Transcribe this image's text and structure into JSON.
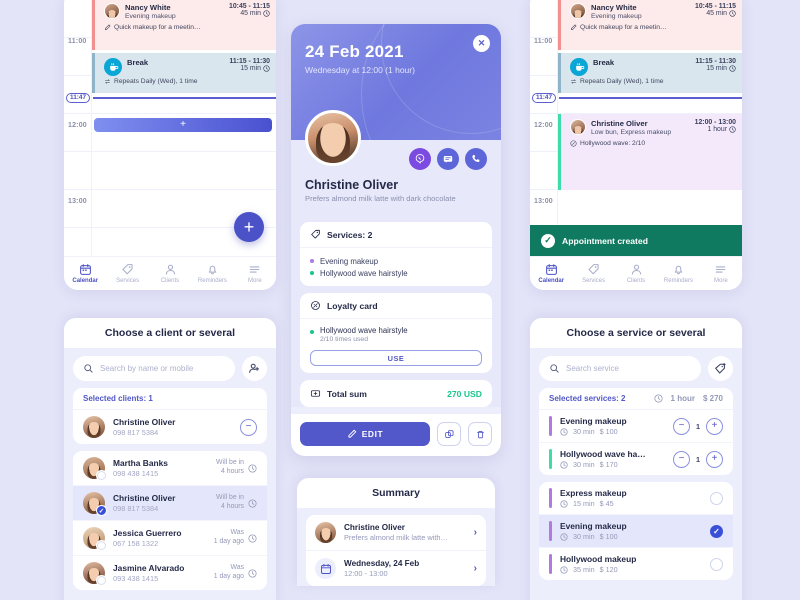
{
  "app": {
    "background": "#e3e4f8",
    "accent": "#5257c9",
    "green": "#19c58a",
    "toast_green": "#0f7a5f",
    "purple_service": "#b07ae0",
    "teal_service": "#3ddcab"
  },
  "tabbar": {
    "items": [
      {
        "label": "Calendar",
        "icon": "calendar-icon",
        "active": true
      },
      {
        "label": "Services",
        "icon": "tag-icon",
        "active": false
      },
      {
        "label": "Clients",
        "icon": "person-icon",
        "active": false
      },
      {
        "label": "Reminders",
        "icon": "bell-icon",
        "active": false
      },
      {
        "label": "More",
        "icon": "menu-icon",
        "active": false
      }
    ]
  },
  "calendar_left": {
    "hours": [
      "11:00",
      "12:00",
      "13:00"
    ],
    "now_label": "11:47",
    "add_slot_label": "+",
    "fab_label": "+",
    "appointments": [
      {
        "name": "Nancy White",
        "service": "Evening makeup",
        "note": "Quick makeup for a meetin…",
        "time": "10:45 - 11:15",
        "duration": "45 min",
        "type": "pink"
      },
      {
        "name": "Break",
        "note": "Repeats Daily (Wed), 1 time",
        "time": "11:15 - 11:30",
        "duration": "15 min",
        "type": "break"
      }
    ]
  },
  "calendar_right": {
    "hours": [
      "11:00",
      "12:00",
      "13:00"
    ],
    "now_label": "11:47",
    "appointments": [
      {
        "name": "Nancy White",
        "service": "Evening makeup",
        "note": "Quick makeup for a meetin…",
        "time": "10:45 - 11:15",
        "duration": "45 min",
        "type": "pink"
      },
      {
        "name": "Break",
        "note": "Repeats Daily (Wed), 1 time",
        "time": "11:15 - 11:30",
        "duration": "15 min",
        "type": "break"
      },
      {
        "name": "Christine Oliver",
        "service": "Low bun, Express makeup",
        "note": "Hollywood wave: 2/10",
        "time": "12:00 - 13:00",
        "duration": "1 hour",
        "type": "purple"
      }
    ],
    "toast": "Appointment created"
  },
  "detail": {
    "date": "24 Feb 2021",
    "when": "Wednesday at 12:00 (1 hour)",
    "close_label": "✕",
    "client_name": "Christine Oliver",
    "client_note": "Prefers almond milk latte with dark chocolate",
    "contacts": [
      {
        "name": "viber-icon"
      },
      {
        "name": "message-icon"
      },
      {
        "name": "phone-icon"
      }
    ],
    "services_title": "Services: 2",
    "services": [
      {
        "label": "Evening makeup",
        "color": "#b07ae0"
      },
      {
        "label": "Hollywood wave hairstyle",
        "color": "#19c58a"
      }
    ],
    "loyalty_title": "Loyalty card",
    "loyalty_service": "Hollywood wave hairstyle",
    "loyalty_progress": "2/10 times used",
    "loyalty_button": "USE",
    "total_label": "Total sum",
    "total_value": "270 USD",
    "edit_label": "EDIT",
    "copy_icon": "copy-icon",
    "delete_icon": "trash-icon"
  },
  "summary": {
    "title": "Summary",
    "rows": [
      {
        "title": "Christine Oliver",
        "sub": "Prefers almond milk latte with…",
        "icon": "avatar"
      },
      {
        "title": "Wednesday, 24 Feb",
        "sub": "12:00 - 13:00",
        "icon": "calendar-icon"
      }
    ]
  },
  "client_sheet": {
    "title": "Choose a client or several",
    "search_placeholder": "Search by name or mobile",
    "add_icon": "add-person-icon",
    "selected_header": "Selected clients: 1",
    "selected": [
      {
        "name": "Christine Oliver",
        "phone": "098 817 5384",
        "action": "remove"
      }
    ],
    "clients": [
      {
        "name": "Martha Banks",
        "phone": "098 438 1415",
        "status1": "Will be in",
        "status2": "4 hours",
        "selected": false
      },
      {
        "name": "Christine Oliver",
        "phone": "098 817 5384",
        "status1": "Will be in",
        "status2": "4 hours",
        "selected": true
      },
      {
        "name": "Jessica Guerrero",
        "phone": "067 158 1322",
        "status1": "Was",
        "status2": "1 day ago",
        "selected": false
      },
      {
        "name": "Jasmine Alvarado",
        "phone": "093 438 1415",
        "status1": "Was",
        "status2": "1 day ago",
        "selected": false
      }
    ]
  },
  "service_sheet": {
    "title": "Choose a service or several",
    "search_placeholder": "Search service",
    "add_icon": "add-tag-icon",
    "selected_header": "Selected services: 2",
    "selected_duration": "1 hour",
    "selected_price": "$ 270",
    "selected": [
      {
        "name": "Evening makeup",
        "duration": "30 min",
        "price": "$ 100",
        "qty": "1",
        "color": "#b07ae0"
      },
      {
        "name": "Hollywood wave ha…",
        "duration": "30 min",
        "price": "$ 170",
        "qty": "1",
        "color": "#3ddcab"
      }
    ],
    "services": [
      {
        "name": "Express makeup",
        "duration": "15 min",
        "price": "$ 45",
        "selected": false,
        "color": "#b07ae0"
      },
      {
        "name": "Evening makeup",
        "duration": "30 min",
        "price": "$ 100",
        "selected": true,
        "color": "#b07ae0"
      },
      {
        "name": "Hollywood makeup",
        "duration": "35 min",
        "price": "$ 120",
        "selected": false,
        "color": "#b07ae0"
      }
    ]
  }
}
